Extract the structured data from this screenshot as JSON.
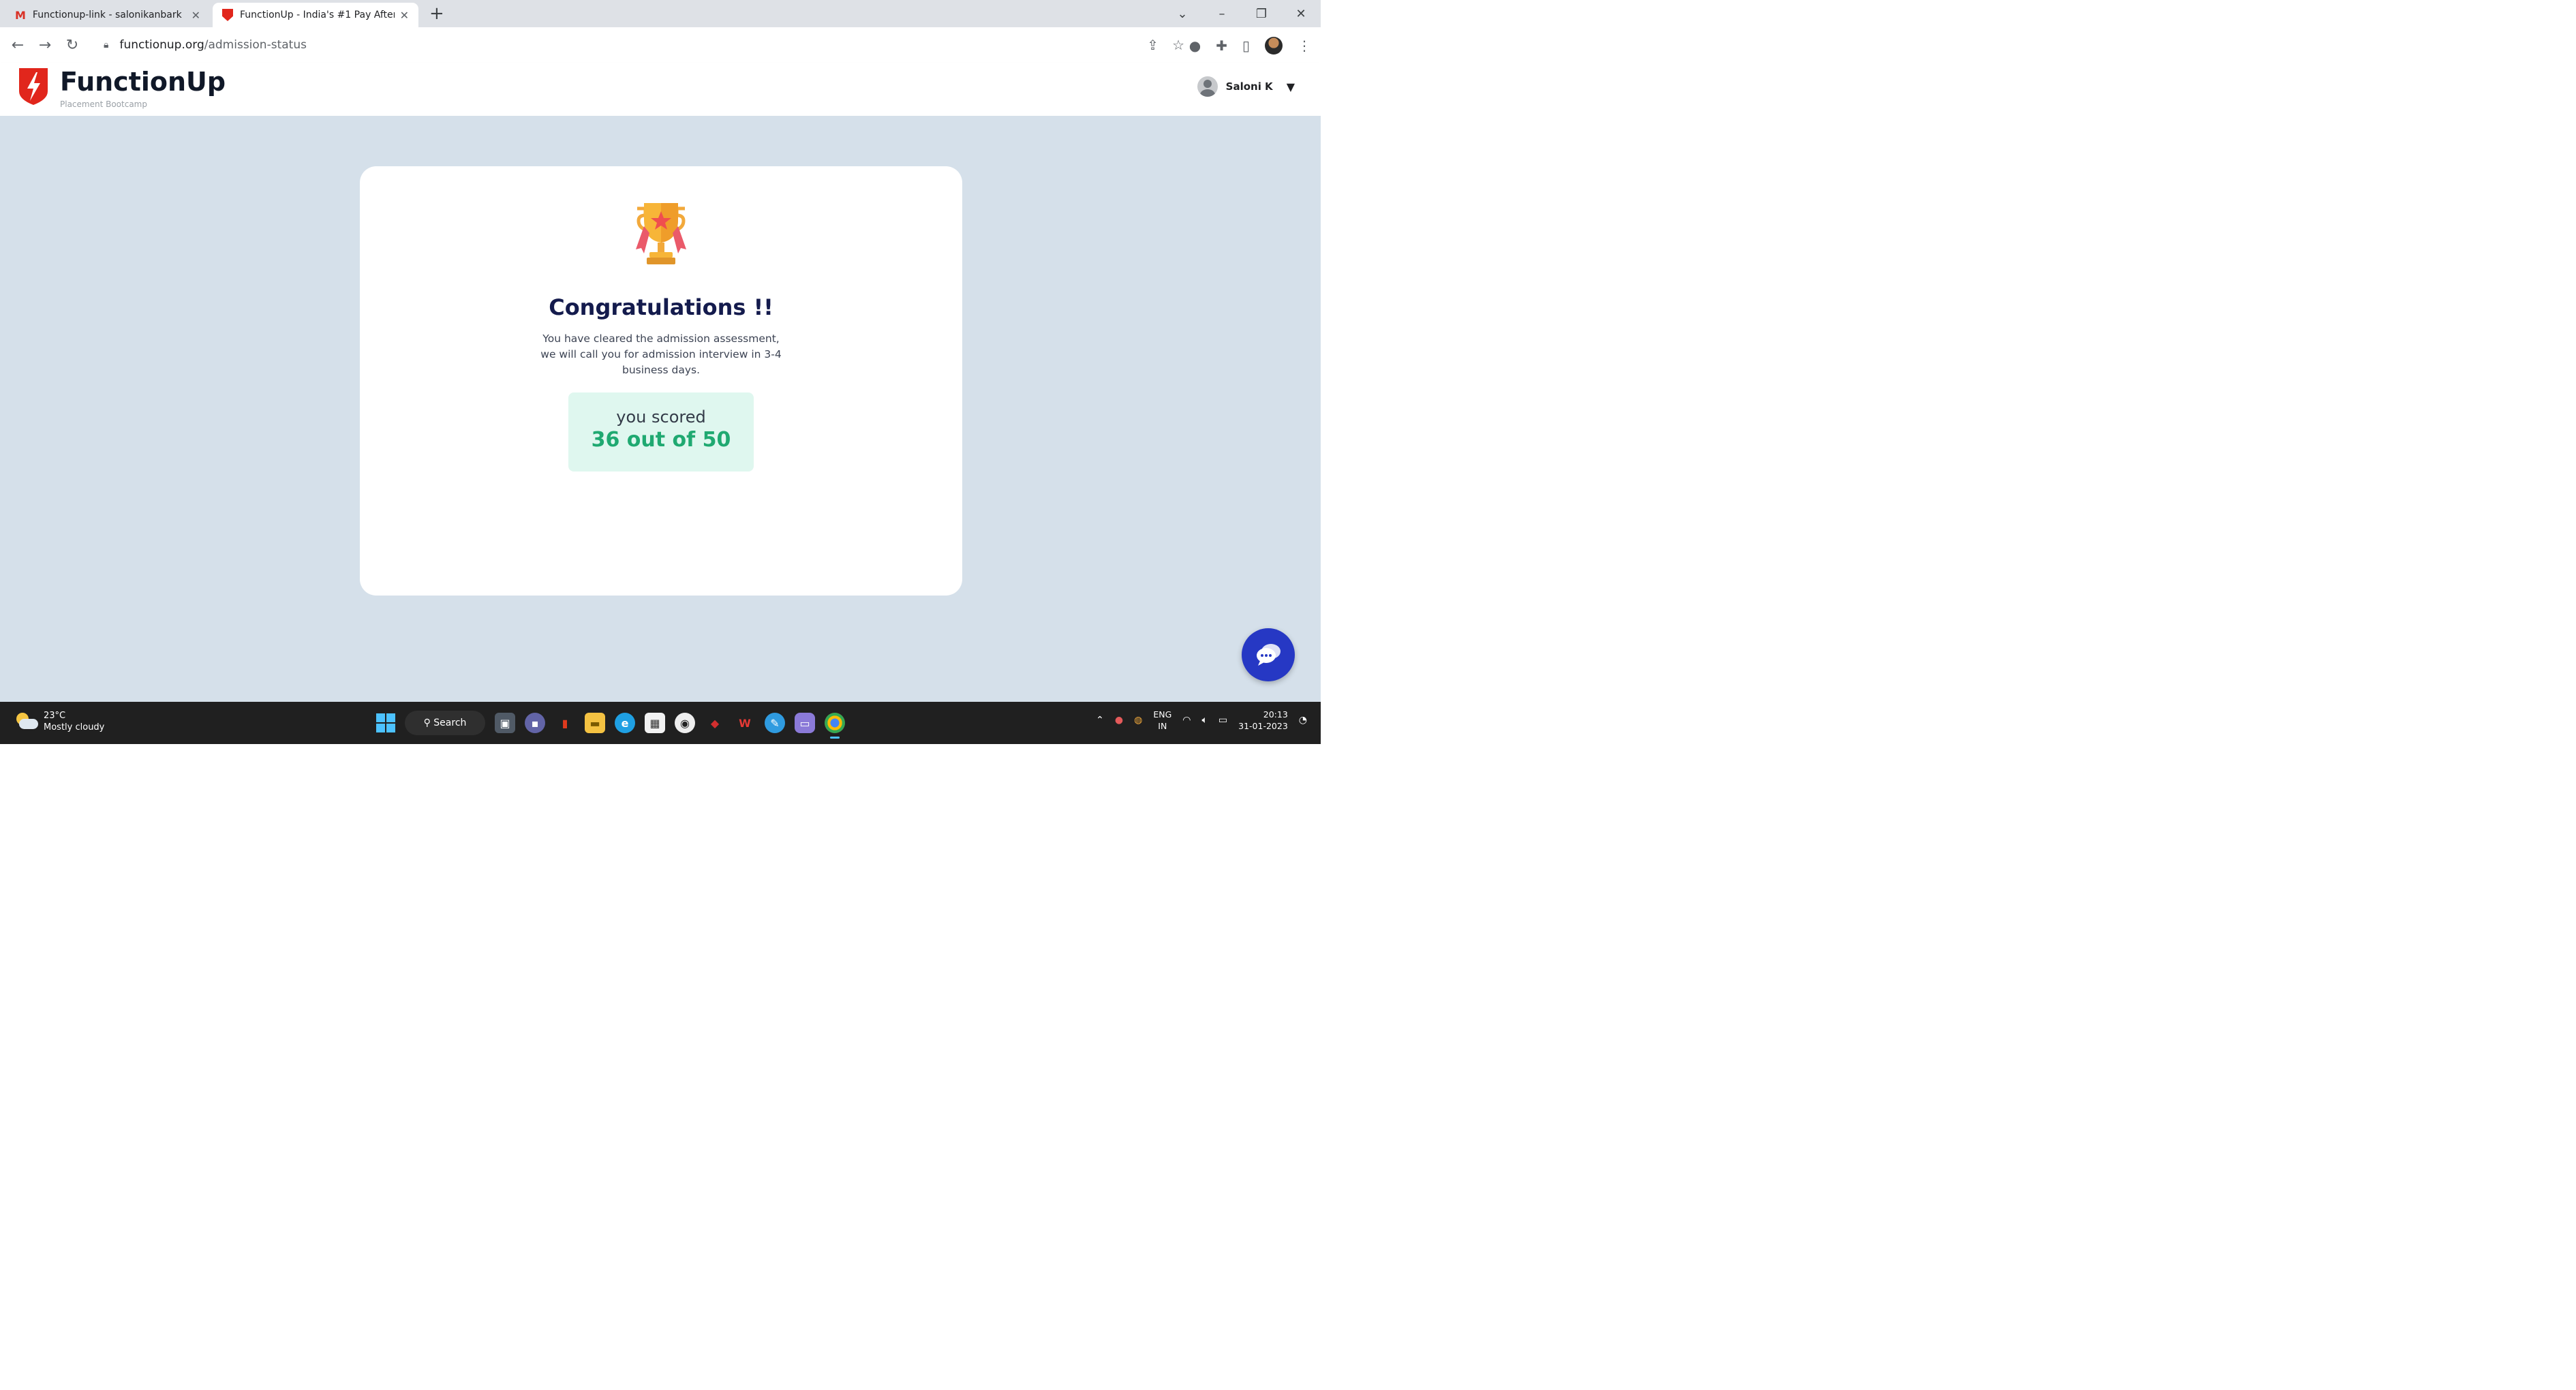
{
  "browser": {
    "tabs": [
      {
        "title": "Functionup-link - salonikanbark",
        "active": false
      },
      {
        "title": "FunctionUp - India's #1 Pay After",
        "active": true
      }
    ],
    "url_host": "functionup.org",
    "url_path": "/admission-status"
  },
  "site": {
    "brand_name": "FunctionUp",
    "brand_tagline": "Placement Bootcamp",
    "user_name": "Saloni K"
  },
  "status_card": {
    "heading": "Congratulations !!",
    "message": "You have cleared the admission assessment, we will call you for admission interview in 3-4 business days.",
    "score_label": "you scored",
    "score_value": "36 out of 50"
  },
  "taskbar": {
    "temperature": "23°C",
    "weather": "Mostly cloudy",
    "search_label": "Search",
    "lang_line1": "ENG",
    "lang_line2": "IN",
    "time": "20:13",
    "date": "31-01-2023"
  },
  "colors": {
    "brand_red": "#e1261c",
    "page_bg": "#d5e0ea",
    "score_bg": "#dff7ef",
    "score_green": "#1fa971",
    "heading_navy": "#141b4d",
    "chat_blue": "#2638c4"
  },
  "icons": [
    "gmail-icon",
    "functionup-favicon",
    "back-icon",
    "forward-icon",
    "reload-icon",
    "lock-icon",
    "share-icon",
    "star-icon",
    "extension-icon",
    "puzzle-icon",
    "side-panel-icon",
    "menu-icon",
    "trophy-icon",
    "chat-icon",
    "windows-start-icon"
  ]
}
